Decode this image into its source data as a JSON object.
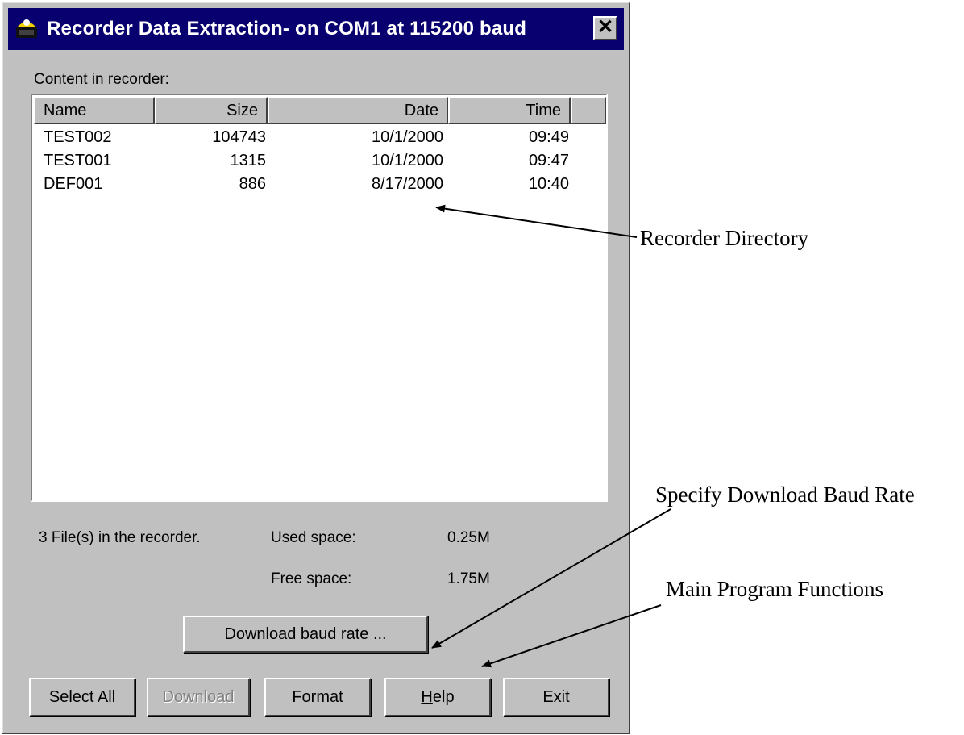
{
  "window": {
    "title": "Recorder Data Extraction- on COM1 at 115200 baud",
    "close_symbol": "✕",
    "app_icon": "recorder-app-icon"
  },
  "content_label": "Content in recorder:",
  "list": {
    "columns": [
      "Name",
      "Size",
      "Date",
      "Time"
    ],
    "rows": [
      {
        "name": "TEST002",
        "size": "104743",
        "date": "10/1/2000",
        "time": "09:49"
      },
      {
        "name": "TEST001",
        "size": "1315",
        "date": "10/1/2000",
        "time": "09:47"
      },
      {
        "name": "DEF001",
        "size": "886",
        "date": "8/17/2000",
        "time": "10:40"
      }
    ]
  },
  "status": {
    "file_count": "3 File(s) in the recorder.",
    "used_label": "Used space:",
    "used_value": "0.25M",
    "free_label": "Free space:",
    "free_value": "1.75M"
  },
  "buttons": {
    "baud_rate": "Download baud rate ...",
    "select_all": "Select All",
    "download": "Download",
    "format": "Format",
    "help": "Help",
    "exit": "Exit"
  },
  "callouts": {
    "recorder_directory": "Recorder Directory",
    "baud_rate": "Specify Download Baud Rate",
    "main_functions": "Main Program Functions"
  }
}
